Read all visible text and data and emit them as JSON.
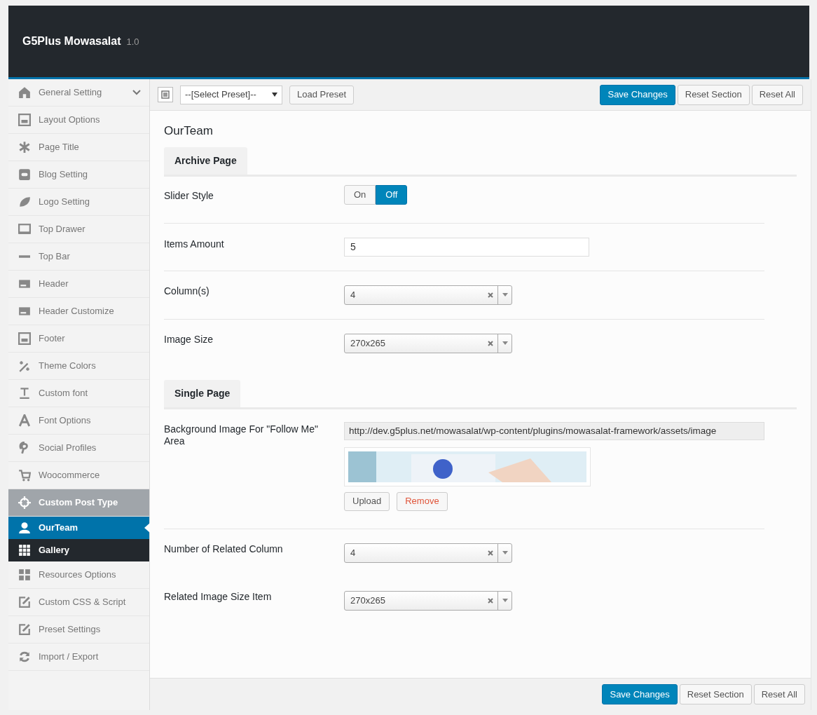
{
  "header": {
    "title": "G5Plus Mowasalat",
    "version": "1.0"
  },
  "sidebar": {
    "items": [
      {
        "label": "General Setting",
        "kind": "group",
        "expanded": false,
        "selected": false
      },
      {
        "label": "Layout Options",
        "kind": "item",
        "selected": false
      },
      {
        "label": "Page Title",
        "kind": "item",
        "selected": false
      },
      {
        "label": "Blog Setting",
        "kind": "item",
        "selected": false
      },
      {
        "label": "Logo Setting",
        "kind": "item",
        "selected": false
      },
      {
        "label": "Top Drawer",
        "kind": "item",
        "selected": false
      },
      {
        "label": "Top Bar",
        "kind": "item",
        "selected": false
      },
      {
        "label": "Header",
        "kind": "item",
        "selected": false
      },
      {
        "label": "Header Customize",
        "kind": "item",
        "selected": false
      },
      {
        "label": "Footer",
        "kind": "item",
        "selected": false
      },
      {
        "label": "Theme Colors",
        "kind": "item",
        "selected": false
      },
      {
        "label": "Custom font",
        "kind": "item",
        "selected": false
      },
      {
        "label": "Font Options",
        "kind": "item",
        "selected": false
      },
      {
        "label": "Social Profiles",
        "kind": "item",
        "selected": false
      },
      {
        "label": "Woocommerce",
        "kind": "item",
        "selected": false
      },
      {
        "label": "Custom Post Type",
        "kind": "group",
        "expanded": true,
        "selected": false,
        "children": [
          {
            "label": "OurTeam",
            "selected": true
          },
          {
            "label": "Gallery",
            "selected": false
          }
        ]
      },
      {
        "label": "Resources Options",
        "kind": "item",
        "selected": false
      },
      {
        "label": "Custom CSS & Script",
        "kind": "item",
        "selected": false
      },
      {
        "label": "Preset Settings",
        "kind": "item",
        "selected": false
      },
      {
        "label": "Import / Export",
        "kind": "item",
        "selected": false
      }
    ]
  },
  "toolbar": {
    "preset_select": "--[Select Preset]--",
    "load_button": "Load Preset",
    "buttons": [
      "Save Changes",
      "Reset Section",
      "Reset All"
    ]
  },
  "section_title": "OurTeam",
  "sections": [
    {
      "tab": "Archive Page",
      "fields": [
        {
          "kind": "toggle",
          "label": "Slider Style",
          "options": [
            {
              "label": "On",
              "selected": false
            },
            {
              "label": "Off",
              "selected": true
            }
          ]
        },
        {
          "kind": "text",
          "label": "Items Amount",
          "value": "5"
        },
        {
          "kind": "select",
          "label": "Column(s)",
          "value": "4"
        },
        {
          "kind": "select",
          "label": "Image Size",
          "value": "270x265"
        }
      ]
    },
    {
      "tab": "Single Page",
      "fields": [
        {
          "kind": "media",
          "label": "Background Image For \"Follow Me\" Area",
          "value": "http://dev.g5plus.net/mowasalat/wp-content/plugins/mowasalat-framework/assets/image",
          "buttons": [
            "Upload",
            "Remove"
          ]
        },
        {
          "kind": "select",
          "label": "Number of Related Column",
          "value": "4"
        },
        {
          "kind": "select",
          "label": "Related Image Size Item",
          "value": "270x265"
        }
      ]
    }
  ],
  "footer": {
    "buttons": [
      "Save Changes",
      "Reset Section",
      "Reset All"
    ]
  }
}
